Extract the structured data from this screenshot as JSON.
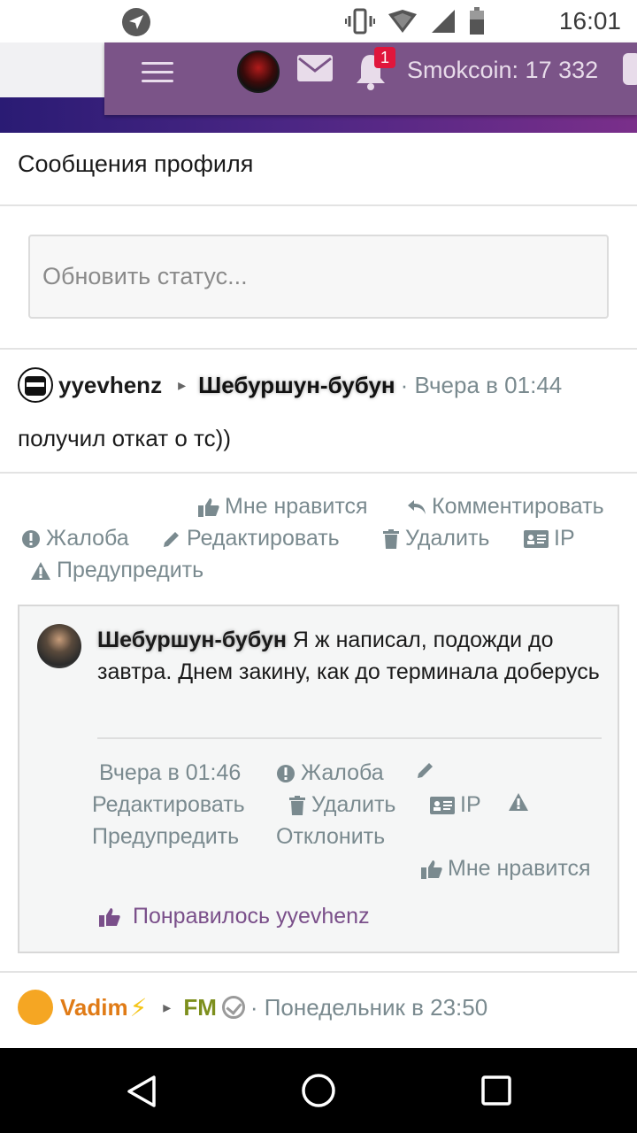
{
  "status_bar": {
    "time": "16:01"
  },
  "header": {
    "notification_count": "1",
    "smokcoin": "Smokcoin: 17 332"
  },
  "page": {
    "title": "Сообщения профиля"
  },
  "status_update": {
    "placeholder": "Обновить статус..."
  },
  "post": {
    "author": "yyevhenz",
    "recipient": "Шебуршун-бубун",
    "time": "· Вчера в 01:44",
    "text": "получил откат о тс))",
    "actions": {
      "like": "Мне нравится",
      "comment": "Комментировать",
      "report": "Жалоба",
      "edit": "Редактировать",
      "delete": "Удалить",
      "ip": "IP",
      "warn": "Предупредить"
    }
  },
  "comment": {
    "author": "Шебуршун-бубун",
    "text": " Я ж написал, подожди до завтра. Днем закину, как до терминала доберусь",
    "time": "Вчера в 01:46",
    "actions": {
      "report": "Жалоба",
      "edit": "Редактировать",
      "delete": "Удалить",
      "ip": "IP",
      "warn": "Предупредить",
      "reject": "Отклонить",
      "like": "Мне нравится"
    },
    "liked_by": "Понравилось yyevhenz"
  },
  "next_post": {
    "author": "Vadim",
    "author_suffix": "⚡",
    "recipient": "FM",
    "time": "· Понедельник в 23:50"
  },
  "colors": {
    "header_purple": "#7b5488",
    "liked_purple": "#7a4f8a",
    "meta_gray": "#7a8a8f",
    "badge_red": "#e0163c",
    "vadim_orange": "#e07b16",
    "fm_olive": "#7d8f1d"
  },
  "icons": [
    "navigation-icon",
    "vibrate-icon",
    "wifi-icon",
    "signal-icon",
    "battery-icon",
    "hamburger-icon",
    "mail-icon",
    "bell-icon",
    "thumbs-up-icon",
    "reply-icon",
    "alert-circle-icon",
    "pencil-icon",
    "trash-icon",
    "id-card-icon",
    "warning-triangle-icon",
    "verified-icon",
    "back-icon",
    "home-icon",
    "recents-icon"
  ]
}
